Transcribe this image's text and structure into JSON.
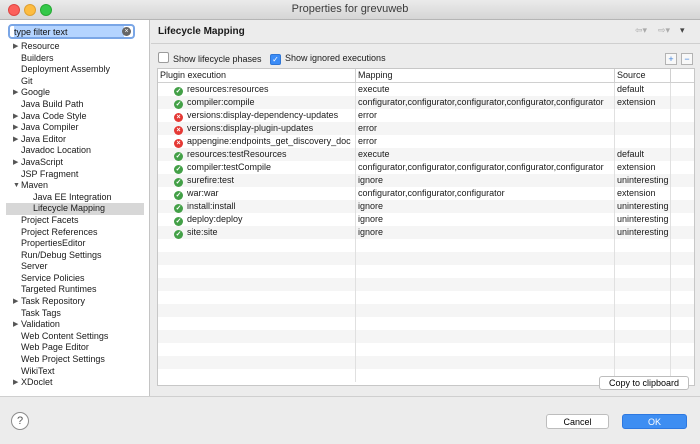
{
  "window": {
    "title": "Properties for grevuweb"
  },
  "filter": {
    "value": "type filter text"
  },
  "tree": [
    {
      "label": "Resource",
      "expandable": true,
      "child": false,
      "selected": false
    },
    {
      "label": "Builders",
      "expandable": false,
      "child": false,
      "selected": false
    },
    {
      "label": "Deployment Assembly",
      "expandable": false,
      "child": false,
      "selected": false
    },
    {
      "label": "Git",
      "expandable": false,
      "child": false,
      "selected": false
    },
    {
      "label": "Google",
      "expandable": true,
      "child": false,
      "selected": false
    },
    {
      "label": "Java Build Path",
      "expandable": false,
      "child": false,
      "selected": false
    },
    {
      "label": "Java Code Style",
      "expandable": true,
      "child": false,
      "selected": false
    },
    {
      "label": "Java Compiler",
      "expandable": true,
      "child": false,
      "selected": false
    },
    {
      "label": "Java Editor",
      "expandable": true,
      "child": false,
      "selected": false
    },
    {
      "label": "Javadoc Location",
      "expandable": false,
      "child": false,
      "selected": false
    },
    {
      "label": "JavaScript",
      "expandable": true,
      "child": false,
      "selected": false
    },
    {
      "label": "JSP Fragment",
      "expandable": false,
      "child": false,
      "selected": false
    },
    {
      "label": "Maven",
      "expandable": true,
      "expanded": true,
      "child": false,
      "selected": false
    },
    {
      "label": "Java EE Integration",
      "expandable": false,
      "child": true,
      "selected": false
    },
    {
      "label": "Lifecycle Mapping",
      "expandable": false,
      "child": true,
      "selected": true
    },
    {
      "label": "Project Facets",
      "expandable": false,
      "child": false,
      "selected": false
    },
    {
      "label": "Project References",
      "expandable": false,
      "child": false,
      "selected": false
    },
    {
      "label": "PropertiesEditor",
      "expandable": false,
      "child": false,
      "selected": false
    },
    {
      "label": "Run/Debug Settings",
      "expandable": false,
      "child": false,
      "selected": false
    },
    {
      "label": "Server",
      "expandable": false,
      "child": false,
      "selected": false
    },
    {
      "label": "Service Policies",
      "expandable": false,
      "child": false,
      "selected": false
    },
    {
      "label": "Targeted Runtimes",
      "expandable": false,
      "child": false,
      "selected": false
    },
    {
      "label": "Task Repository",
      "expandable": true,
      "child": false,
      "selected": false
    },
    {
      "label": "Task Tags",
      "expandable": false,
      "child": false,
      "selected": false
    },
    {
      "label": "Validation",
      "expandable": true,
      "child": false,
      "selected": false
    },
    {
      "label": "Web Content Settings",
      "expandable": false,
      "child": false,
      "selected": false
    },
    {
      "label": "Web Page Editor",
      "expandable": false,
      "child": false,
      "selected": false
    },
    {
      "label": "Web Project Settings",
      "expandable": false,
      "child": false,
      "selected": false
    },
    {
      "label": "WikiText",
      "expandable": false,
      "child": false,
      "selected": false
    },
    {
      "label": "XDoclet",
      "expandable": true,
      "child": false,
      "selected": false
    }
  ],
  "main": {
    "title": "Lifecycle Mapping",
    "show_lifecycle_phases": {
      "label": "Show lifecycle phases",
      "checked": false
    },
    "show_ignored": {
      "label": "Show ignored executions",
      "checked": true
    },
    "columns": [
      "Plugin execution",
      "Mapping",
      "Source"
    ],
    "rows": [
      {
        "status": "ok",
        "execution": "resources:resources",
        "mapping": "execute",
        "source": "default"
      },
      {
        "status": "ok",
        "execution": "compiler:compile",
        "mapping": "configurator,configurator,configurator,configurator,configurator",
        "source": "extension"
      },
      {
        "status": "error",
        "execution": "versions:display-dependency-updates",
        "mapping": "error",
        "source": ""
      },
      {
        "status": "error",
        "execution": "versions:display-plugin-updates",
        "mapping": "error",
        "source": ""
      },
      {
        "status": "error",
        "execution": "appengine:endpoints_get_discovery_doc",
        "mapping": "error",
        "source": ""
      },
      {
        "status": "ok",
        "execution": "resources:testResources",
        "mapping": "execute",
        "source": "default"
      },
      {
        "status": "ok",
        "execution": "compiler:testCompile",
        "mapping": "configurator,configurator,configurator,configurator,configurator",
        "source": "extension"
      },
      {
        "status": "ok",
        "execution": "surefire:test",
        "mapping": "ignore",
        "source": "uninteresting"
      },
      {
        "status": "ok",
        "execution": "war:war",
        "mapping": "configurator,configurator,configurator",
        "source": "extension"
      },
      {
        "status": "ok",
        "execution": "install:install",
        "mapping": "ignore",
        "source": "uninteresting"
      },
      {
        "status": "ok",
        "execution": "deploy:deploy",
        "mapping": "ignore",
        "source": "uninteresting"
      },
      {
        "status": "ok",
        "execution": "site:site",
        "mapping": "ignore",
        "source": "uninteresting"
      }
    ],
    "copy_label": "Copy to clipboard"
  },
  "footer": {
    "help": "?",
    "cancel": "Cancel",
    "ok": "OK"
  },
  "icons": {
    "ok": "check-icon",
    "error": "error-icon"
  },
  "colors": {
    "ok": "#43a047",
    "error": "#e53935",
    "accent": "#3e8ef2"
  }
}
